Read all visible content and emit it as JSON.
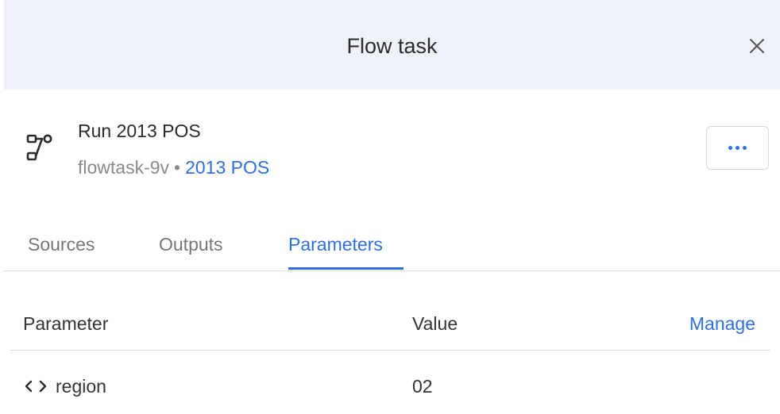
{
  "header": {
    "title": "Flow task",
    "close_icon": "close-icon"
  },
  "task": {
    "icon": "flow-icon",
    "name": "Run 2013 POS",
    "id": "flowtask-9v",
    "separator": "•",
    "flow_link": "2013 POS",
    "more_icon": "more-horizontal-icon"
  },
  "tabs": [
    {
      "label": "Sources",
      "active": false
    },
    {
      "label": "Outputs",
      "active": false
    },
    {
      "label": "Parameters",
      "active": true
    }
  ],
  "table": {
    "columns": {
      "parameter": "Parameter",
      "value": "Value"
    },
    "manage_label": "Manage",
    "rows": [
      {
        "icon": "code-icon",
        "name": "region",
        "value": "02"
      }
    ]
  },
  "colors": {
    "accent": "#2f6fde",
    "header_bg": "#eef2f8",
    "text": "#333333",
    "muted": "#8a8a8a"
  }
}
